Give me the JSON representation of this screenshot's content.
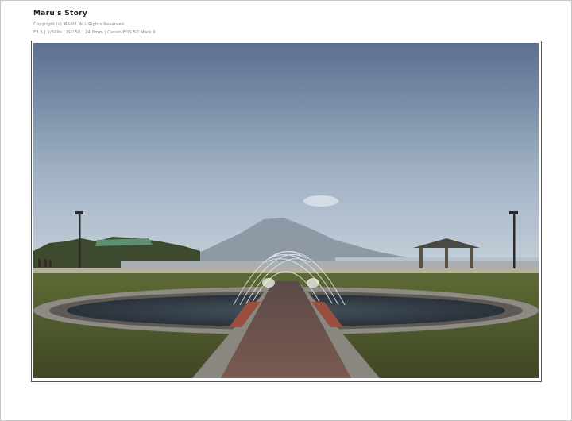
{
  "header": {
    "title": "Maru's Story",
    "copyright": "Copyright (c) MARU. ALL Rights Reserved",
    "exif": "F3.5 | 1/500s | ISO 50 | 24.0mm | Canon EOS 5D Mark II"
  },
  "photo": {
    "subject": "fountain-park-with-volcano",
    "colors": {
      "sky_top": "#5b6f8f",
      "sky_bottom": "#c7d2dc",
      "mountain": "#8f99a5",
      "grass": "#4f5a2c",
      "water": "#2d3740",
      "paving": "#7a4d46"
    }
  }
}
